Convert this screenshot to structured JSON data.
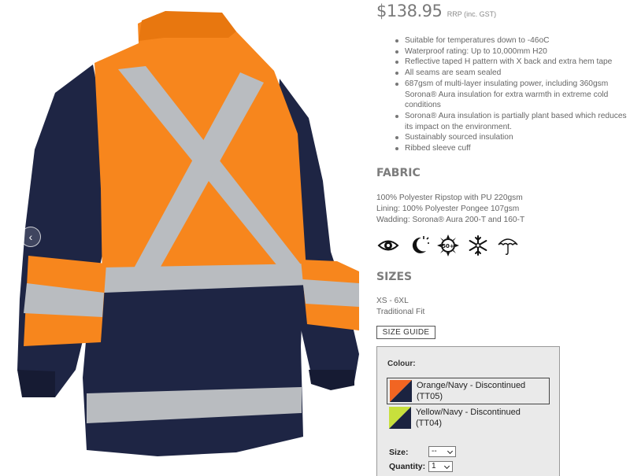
{
  "product": {
    "price": "$138.95",
    "price_note": "RRP (inc. GST)",
    "features": [
      "Suitable for temperatures down to -46oC",
      "Waterproof rating: Up to 10,000mm H20",
      "Reflective taped H pattern with X back and extra hem tape",
      "All seams are seam sealed",
      "687gsm of multi-layer insulating power, including 360gsm Sorona® Aura insulation for extra warmth in extreme cold conditions",
      "Sorona® Aura insulation is partially plant based which reduces its impact on the environment.",
      "Sustainably sourced insulation",
      "Ribbed sleeve cuff"
    ]
  },
  "gallery": {
    "prev_icon": "chevron-left-icon",
    "next_icon": "chevron-right-icon",
    "prev_glyph": "‹",
    "next_glyph": "›"
  },
  "fabric": {
    "title": "FABRIC",
    "lines": [
      "100% Polyester Ripstop with PU 220gsm",
      "Lining: 100% Polyester Pongee 107gsm",
      "Wadding: Sorona® Aura 200-T and 160-T"
    ]
  },
  "care_icons": [
    "eye-icon",
    "moon-icon",
    "upf-50-sun-icon",
    "snowflake-icon",
    "umbrella-icon"
  ],
  "upf_text": "50+",
  "sizes": {
    "title": "SIZES",
    "lines": [
      "XS - 6XL",
      "Traditional Fit"
    ],
    "guide_button": "SIZE GUIDE"
  },
  "options": {
    "colour_label": "Colour:",
    "colours": [
      {
        "label_line1": "Orange/Navy - Discontinued",
        "label_line2": "(TT05)",
        "primary": "#f26522",
        "secondary": "#1b2340",
        "selected": true
      },
      {
        "label_line1": "Yellow/Navy - Discontinued",
        "label_line2": "(TT04)",
        "primary": "#c8e03c",
        "secondary": "#1b2340",
        "selected": false
      }
    ],
    "size_label": "Size:",
    "size_value": "--",
    "quantity_label": "Quantity:",
    "quantity_value": "1"
  },
  "colors": {
    "hivis_orange": "#f7861d",
    "navy": "#1e2544",
    "reflective_silver": "#b9bcc0"
  }
}
